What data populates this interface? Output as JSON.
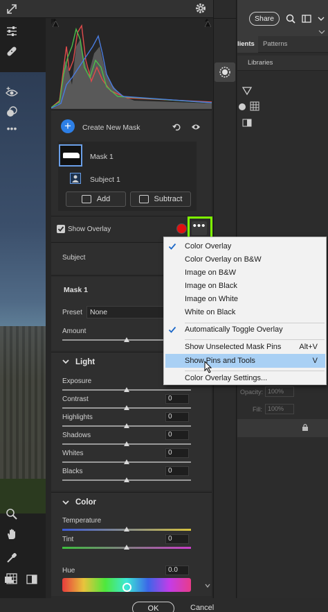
{
  "histogram": {
    "series_colors": [
      "#e04b4b",
      "#4bbf4b",
      "#4a7ce0",
      "#9a9a9a"
    ]
  },
  "masks": {
    "create_label": "Create New Mask",
    "mask_name": "Mask 1",
    "subject_name": "Subject 1",
    "add_label": "Add",
    "subtract_label": "Subtract",
    "show_overlay_label": "Show Overlay",
    "overlay_color": "#e01010"
  },
  "subject_section": {
    "label": "Subject"
  },
  "mask_panel": {
    "title": "Mask 1",
    "preset_label": "Preset",
    "preset_value": "None",
    "amount_label": "Amount"
  },
  "light": {
    "title": "Light",
    "sliders": [
      {
        "label": "Exposure",
        "value": ""
      },
      {
        "label": "Contrast",
        "value": "0"
      },
      {
        "label": "Highlights",
        "value": "0"
      },
      {
        "label": "Shadows",
        "value": "0"
      },
      {
        "label": "Whites",
        "value": "0"
      },
      {
        "label": "Blacks",
        "value": "0"
      }
    ]
  },
  "color": {
    "title": "Color",
    "sliders": [
      {
        "label": "Temperature",
        "value": ""
      },
      {
        "label": "Tint",
        "value": "0"
      },
      {
        "label": "Hue",
        "value": "0.0"
      }
    ]
  },
  "footer": {
    "ok_label": "OK",
    "cancel_label": "Cancel"
  },
  "right_app": {
    "share_label": "Share",
    "tab_gradients": "lients",
    "tab_patterns": "Patterns",
    "tab_libraries": "Libraries",
    "opacity_label": "Opacity:",
    "opacity_value": "100%",
    "fill_label": "Fill:",
    "fill_value": "100%"
  },
  "context_menu": {
    "items": [
      {
        "label": "Color Overlay",
        "shortcut": "",
        "checked": true
      },
      {
        "label": "Color Overlay on B&W",
        "shortcut": "",
        "checked": false
      },
      {
        "label": "Image on B&W",
        "shortcut": "",
        "checked": false
      },
      {
        "label": "Image on Black",
        "shortcut": "",
        "checked": false
      },
      {
        "label": "Image on White",
        "shortcut": "",
        "checked": false
      },
      {
        "label": "White on Black",
        "shortcut": "",
        "checked": false
      },
      {
        "label": "Automatically Toggle Overlay",
        "shortcut": "",
        "checked": true
      },
      {
        "label": "Show Unselected Mask Pins",
        "shortcut": "Alt+V",
        "checked": false
      },
      {
        "label": "Show Pins and Tools",
        "shortcut": "V",
        "checked": false,
        "highlighted": true
      },
      {
        "label": "Color Overlay Settings...",
        "shortcut": "",
        "checked": false
      }
    ]
  },
  "highlight_color": "#7fff00"
}
